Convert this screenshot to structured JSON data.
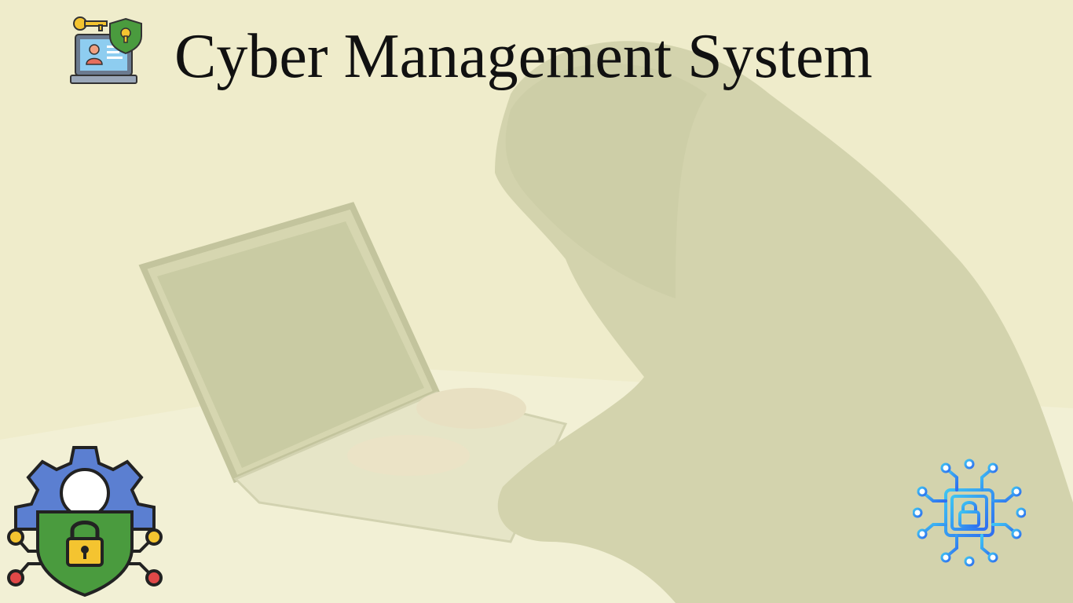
{
  "header": {
    "title": "Cyber Management System"
  },
  "icons": {
    "logo": "laptop-user-key-shield-icon",
    "bottom_left": "gear-shield-lock-network-icon",
    "bottom_right": "circuit-chip-lock-icon"
  },
  "colors": {
    "background": "#efeccb",
    "title_text": "#111111",
    "shield_green": "#4a9b3e",
    "gear_blue": "#5b7fd1",
    "lock_yellow": "#f4c430",
    "node_red": "#e04848",
    "chip_blue": "#3b8df0"
  }
}
